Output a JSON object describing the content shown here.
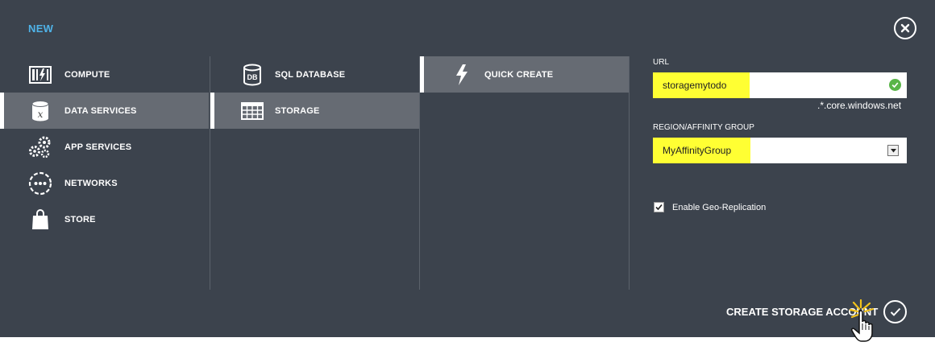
{
  "dialog": {
    "title": "NEW",
    "close_icon": "close-icon"
  },
  "categories": [
    {
      "label": "COMPUTE",
      "icon": "compute-icon",
      "selected": false
    },
    {
      "label": "DATA SERVICES",
      "icon": "data-services-icon",
      "selected": true
    },
    {
      "label": "APP SERVICES",
      "icon": "app-services-icon",
      "selected": false
    },
    {
      "label": "NETWORKS",
      "icon": "networks-icon",
      "selected": false
    },
    {
      "label": "STORE",
      "icon": "store-icon",
      "selected": false
    }
  ],
  "services": [
    {
      "label": "SQL DATABASE",
      "icon": "sql-database-icon",
      "icon_text": "DB",
      "selected": false
    },
    {
      "label": "STORAGE",
      "icon": "storage-icon",
      "selected": true
    }
  ],
  "methods": [
    {
      "label": "QUICK CREATE",
      "icon": "lightning-icon",
      "selected": true
    }
  ],
  "form": {
    "url_label": "URL",
    "url_value": "storagemytodo",
    "url_suffix": ".*.core.windows.net",
    "region_label": "REGION/AFFINITY GROUP",
    "region_value": "MyAffinityGroup",
    "geo_replication_label": "Enable Geo-Replication",
    "geo_replication_checked": true,
    "create_label": "CREATE STORAGE ACCOUNT"
  },
  "colors": {
    "panel": "#3c434d",
    "accent": "#4fb3e8",
    "selected_row": "#666b73",
    "highlight": "#ffff33",
    "valid": "#59b548"
  }
}
